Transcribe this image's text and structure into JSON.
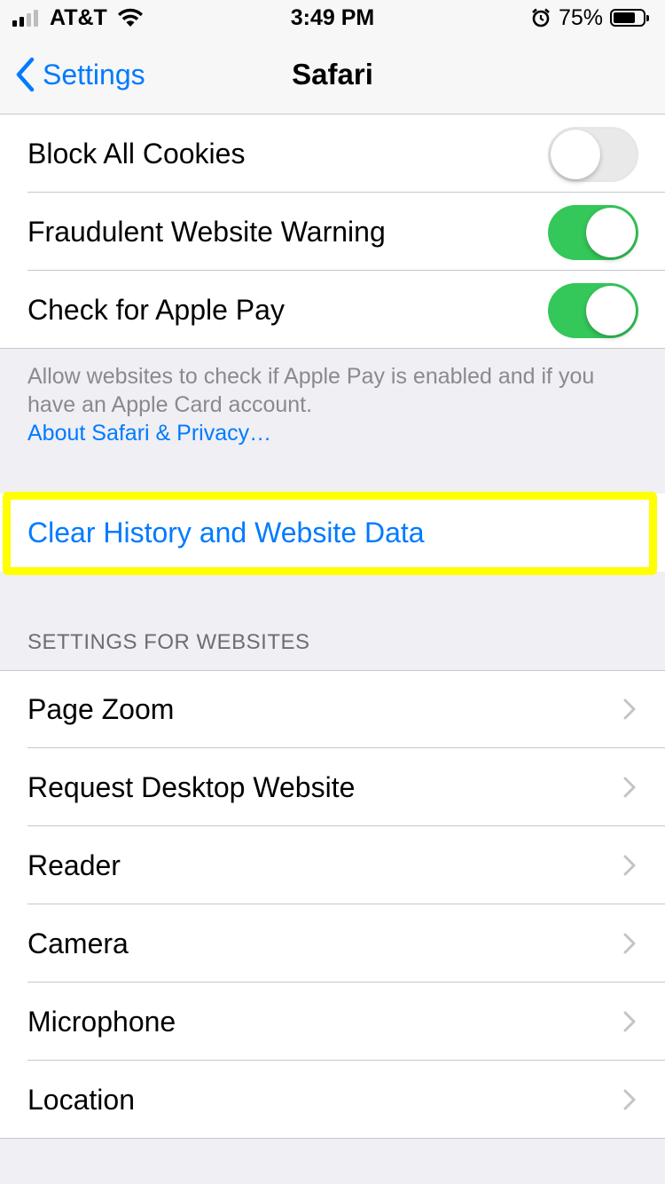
{
  "status_bar": {
    "carrier": "AT&T",
    "time": "3:49 PM",
    "battery_percent": "75%",
    "battery_level": 0.75,
    "signal_bars_filled": 2,
    "signal_bars_total": 4
  },
  "nav": {
    "back_label": "Settings",
    "title": "Safari"
  },
  "toggles": [
    {
      "label": "Block All Cookies",
      "on": false
    },
    {
      "label": "Fraudulent Website Warning",
      "on": true
    },
    {
      "label": "Check for Apple Pay",
      "on": true
    }
  ],
  "footer": {
    "text": "Allow websites to check if Apple Pay is enabled and if you have an Apple Card account.",
    "link": "About Safari & Privacy…"
  },
  "clear_history": {
    "label": "Clear History and Website Data",
    "highlight_color": "#ffff00"
  },
  "settings_for_websites": {
    "header": "SETTINGS FOR WEBSITES",
    "items": [
      {
        "label": "Page Zoom"
      },
      {
        "label": "Request Desktop Website"
      },
      {
        "label": "Reader"
      },
      {
        "label": "Camera"
      },
      {
        "label": "Microphone"
      },
      {
        "label": "Location"
      }
    ]
  },
  "colors": {
    "accent": "#007aff",
    "toggle_on": "#34c759",
    "background": "#efeff4"
  },
  "icons": {
    "back": "chevron-left-icon",
    "disclosure": "chevron-right-icon",
    "wifi": "wifi-icon",
    "alarm": "alarm-clock-icon",
    "battery": "battery-icon",
    "signal": "signal-bars-icon"
  }
}
